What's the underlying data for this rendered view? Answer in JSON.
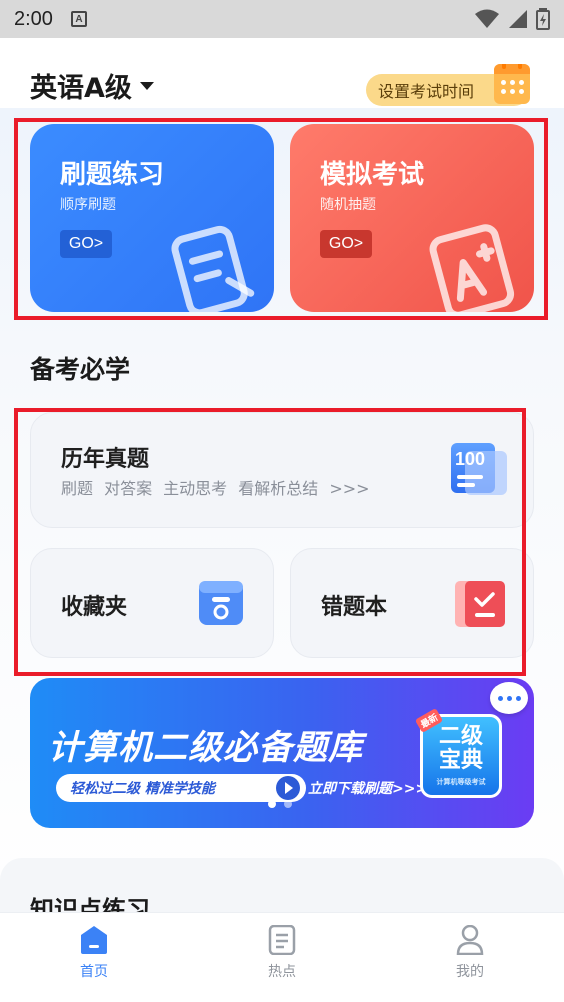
{
  "status_bar": {
    "time": "2:00",
    "notification_letter": "A"
  },
  "header": {
    "subject": "英语A级",
    "exam_time_button": "设置考试时间"
  },
  "practice_cards": [
    {
      "title": "刷题练习",
      "subtitle": "顺序刷题",
      "go": "GO>",
      "color": "#2f7cf8"
    },
    {
      "title": "模拟考试",
      "subtitle": "随机抽题",
      "go": "GO>",
      "color": "#f25d4f"
    }
  ],
  "section": {
    "title": "备考必学"
  },
  "past_papers": {
    "title": "历年真题",
    "tags": "刷题 对答案 主动思考 看解析总结 >>>",
    "badge": "100"
  },
  "favorites": {
    "title": "收藏夹"
  },
  "wrong_book": {
    "title": "错题本"
  },
  "banner": {
    "title": "计算机二级必备题库",
    "pill_text": "轻松过二级  精准学技能",
    "link_text": "立即下载刷题>>>",
    "book_line1": "二级",
    "book_line2": "宝典",
    "book_caption": "计算机等级考试",
    "book_badge": "最新"
  },
  "knowledge": {
    "title": "知识点练习"
  },
  "tabs": [
    {
      "label": "首页",
      "active": true
    },
    {
      "label": "热点",
      "active": false
    },
    {
      "label": "我的",
      "active": false
    }
  ],
  "colors": {
    "accent": "#3b82f6",
    "highlight_frame": "#ea1c2a"
  }
}
